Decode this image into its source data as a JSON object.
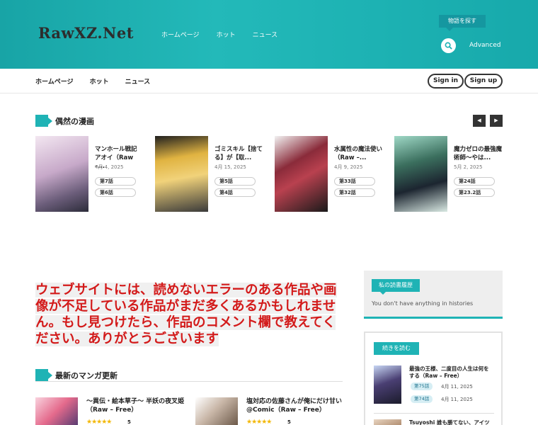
{
  "header": {
    "logo": "RawXZ.Net",
    "nav": [
      "ホームページ",
      "ホット",
      "ニュース"
    ],
    "search_label": "物語を探す",
    "advanced": "Advanced"
  },
  "subnav": {
    "items": [
      "ホームページ",
      "ホット",
      "ニュース"
    ],
    "signin": "Sign in",
    "signup": "Sign up"
  },
  "random": {
    "heading": "偶然の漫画",
    "cards": [
      {
        "title": "マンホール戦記 アオイ（Raw –...",
        "date": "4月 4, 2025",
        "ch1": "第7話",
        "ch2": "第6話",
        "color": "#c7a9c9"
      },
      {
        "title": "ゴミスキル【捨てる】が【取...",
        "date": "4月 15, 2025",
        "ch1": "第5話",
        "ch2": "第4話",
        "color": "#e0b341"
      },
      {
        "title": "水属性の魔法使い（Raw –...",
        "date": "4月 9, 2025",
        "ch1": "第33話",
        "ch2": "第32話",
        "color": "#8a2b3a"
      },
      {
        "title": "魔力ゼロの最強魔術師～やは...",
        "date": "5月 2, 2025",
        "ch1": "第24話",
        "ch2": "第23.2話",
        "color": "#3b6f5e"
      }
    ]
  },
  "notice": "ウェブサイトには、読めないエラーのある作品や画像が不足している作品がまだ多くあるかもしれません。もし見つけたら、作品のコメント欄で教えてください。ありがとうございます",
  "latest": {
    "heading": "最新のマンガ更新",
    "items": [
      {
        "title": "～異伝・絵本草子～ 半妖の夜叉姫（Raw – Free）",
        "stars": "★★★★★",
        "rating": "5",
        "color": "#e46a8c"
      },
      {
        "title": "塩対応の佐藤さんが俺にだけ甘い@Comic（Raw – Free）",
        "stars": "★★★★★",
        "rating": "5",
        "color": "#c9b7a8"
      }
    ]
  },
  "history": {
    "heading": "私の読書履歴",
    "empty": "You don't have anything in histories"
  },
  "continue": {
    "heading": "続きを読む",
    "items": [
      {
        "title": "最強の王様、二度目の人生は何をする（Raw – Free）",
        "ch1": "第75話",
        "d1": "4月 11, 2025",
        "ch2": "第74話",
        "d2": "4月 11, 2025",
        "color": "#4a3f73"
      },
      {
        "title": "Tsuyoshi 誰も勝てない、アイツに",
        "color": "#a37b5c"
      }
    ]
  }
}
